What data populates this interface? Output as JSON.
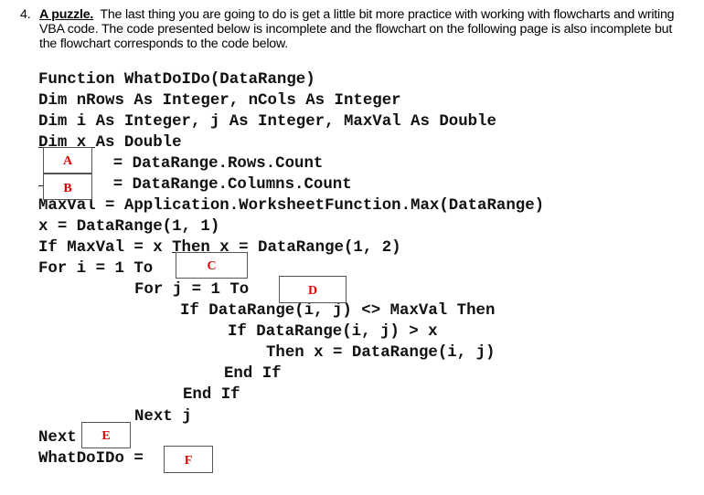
{
  "question": {
    "number": "4.",
    "heading": "A puzzle.",
    "text": "The last thing you are going to do is get a little bit more practice with working with flowcharts and writing VBA code.  The code presented below is incomplete and the flowchart on the following page is also incomplete but the flowchart corresponds to the code below."
  },
  "code": {
    "lines": [
      "Function WhatDoIDo(DataRange)",
      "Dim nRows As Integer, nCols As Integer",
      "Dim i As Integer, j As Integer, MaxVal As Double",
      "Dim x As Double",
      "    = DataRange.Rows.Count",
      "    = DataRange.Columns.Count",
      "MaxVal = Application.WorksheetFunction.Max(DataRange)",
      "x = DataRange(1, 1)",
      "If MaxVal = x Then x = DataRange(1, 2)",
      "For i = 1 To",
      "For j = 1 To",
      "If DataRange(i, j) <> MaxVal Then",
      "If DataRange(i, j) > x",
      "Then x = DataRange(i, j)",
      "End If",
      "End If",
      "Next j",
      "Next",
      "WhatDoIDo ="
    ]
  },
  "blanks": {
    "A": "A",
    "B": "B",
    "C": "C",
    "D": "D",
    "E": "E",
    "F": "F"
  },
  "colors": {
    "blank_label": "#e00000",
    "text": "#111111"
  }
}
